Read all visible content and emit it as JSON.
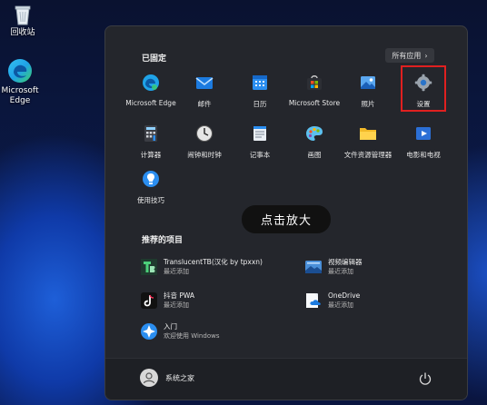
{
  "desktop": {
    "recycle_bin": "回收站",
    "edge_line1": "Microsoft",
    "edge_line2": "Edge"
  },
  "start_menu": {
    "pinned_title": "已固定",
    "all_apps": "所有应用",
    "all_apps_chevron": "›",
    "pinned": [
      {
        "label": "Microsoft Edge",
        "icon": "edge-icon"
      },
      {
        "label": "邮件",
        "icon": "mail-icon"
      },
      {
        "label": "日历",
        "icon": "calendar-icon"
      },
      {
        "label": "Microsoft Store",
        "icon": "store-icon"
      },
      {
        "label": "照片",
        "icon": "photos-icon"
      },
      {
        "label": "设置",
        "icon": "gear-icon"
      },
      {
        "label": "计算器",
        "icon": "calculator-icon"
      },
      {
        "label": "闹钟和时钟",
        "icon": "clock-icon"
      },
      {
        "label": "记事本",
        "icon": "notepad-icon"
      },
      {
        "label": "画图",
        "icon": "paint-icon"
      },
      {
        "label": "文件资源管理器",
        "icon": "folder-icon"
      },
      {
        "label": "电影和电视",
        "icon": "movies-icon"
      },
      {
        "label": "使用技巧",
        "icon": "tips-icon"
      }
    ],
    "toast": "点击放大",
    "recommended_title": "推荐的项目",
    "recommended": [
      {
        "title": "TranslucentTB(汉化 by tpxxn)",
        "sub": "最近添加",
        "icon": "translucenttb-icon"
      },
      {
        "title": "视频编辑器",
        "sub": "最近添加",
        "icon": "video-editor-icon"
      },
      {
        "title": "抖音 PWA",
        "sub": "最近添加",
        "icon": "douyin-icon"
      },
      {
        "title": "OneDrive",
        "sub": "最近添加",
        "icon": "onedrive-icon"
      },
      {
        "title": "入门",
        "sub": "欢迎使用 Windows",
        "icon": "get-started-icon"
      }
    ],
    "user_name": "系统之家"
  },
  "colors": {
    "highlight": "#e02020",
    "menu_bg": "#24262c"
  }
}
